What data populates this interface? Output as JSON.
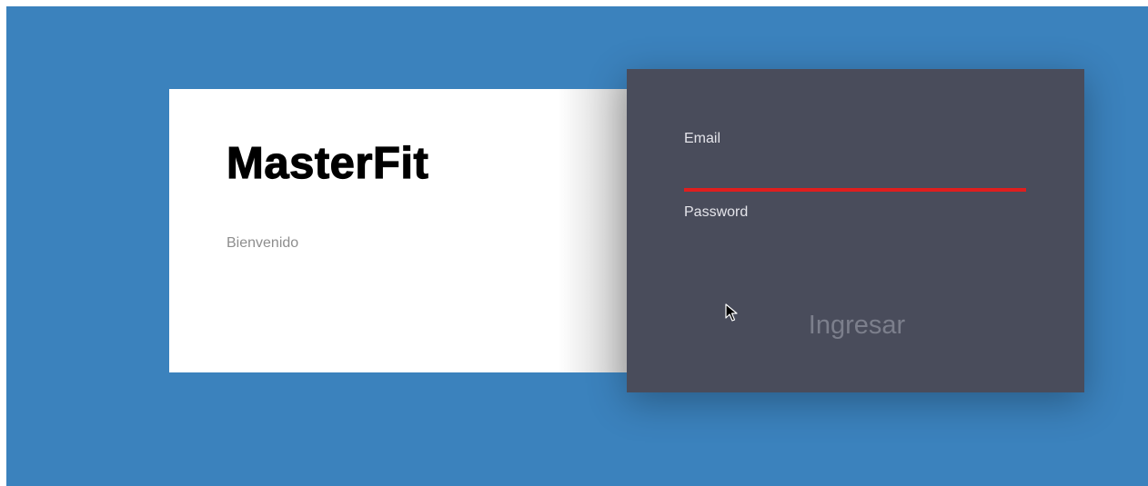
{
  "brand": {
    "title": "MasterFit",
    "subtitle": "Bienvenido"
  },
  "login": {
    "email_label": "Email",
    "email_value": "",
    "password_label": "Password",
    "password_value": "",
    "submit_label": "Ingresar"
  },
  "colors": {
    "background": "#3b82bd",
    "brand_card": "#ffffff",
    "login_card": "#494c5b",
    "active_input_underline": "#e01e1e",
    "submit_text": "#7c7f8c"
  },
  "icons": {
    "cursor": "mouse-pointer-icon"
  }
}
